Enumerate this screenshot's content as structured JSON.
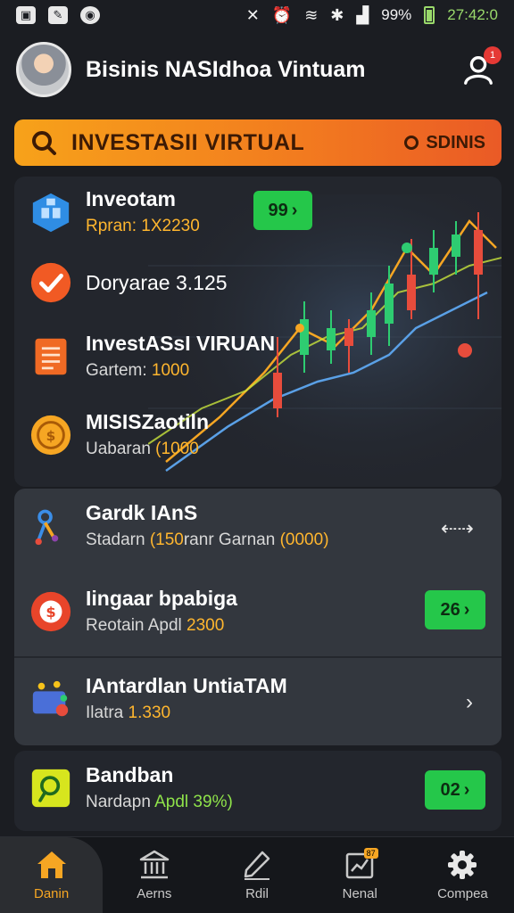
{
  "status_bar": {
    "battery_text": "99%",
    "time": "27:42:0"
  },
  "header": {
    "title": "Bisinis NASIdhoa Vintuam",
    "notification_count": "1"
  },
  "banner": {
    "title": "INVESTASII VIRTUAL",
    "right_label": "SDINIS"
  },
  "card1": {
    "items": [
      {
        "title": "Inveotam",
        "sub_prefix": "",
        "sub_value": "Rpran: 1X2230",
        "pill": "99"
      },
      {
        "title": "Doryarae 3.125",
        "sub_prefix": "",
        "sub_value": ""
      },
      {
        "title": "InvestASsI VIRUAN",
        "sub_prefix": "Gartem: ",
        "sub_value": "1000"
      },
      {
        "title": "MISISZaotiln",
        "sub_prefix": "Uabaran ",
        "sub_value": "(1000"
      }
    ]
  },
  "card2": {
    "items": [
      {
        "title": "Gardk IAnS",
        "sub_prefix": "Stadarn ",
        "sub_value": "(150",
        "sub_mid": "ranr Garnan ",
        "sub_value2": "(0000)",
        "action": "⇠⇢"
      },
      {
        "title": "Iingaar bpabiga",
        "sub_prefix": "Reotain Apdl ",
        "sub_value": "2300",
        "pill": "26"
      },
      {
        "title": "IAntardlan UntiaTAM",
        "sub_prefix": "Ilatra ",
        "sub_value": "1.330"
      }
    ]
  },
  "card3": {
    "title": "Bandban",
    "sub_prefix": "Nardapn ",
    "sub_value": "Apdl 39%)",
    "pill": "02"
  },
  "nav": {
    "items": [
      {
        "label": "Danin",
        "icon": "home-icon"
      },
      {
        "label": "Aerns",
        "icon": "bank-icon"
      },
      {
        "label": "Rdil",
        "icon": "pen-icon"
      },
      {
        "label": "Nenal",
        "icon": "chart-box-icon",
        "badge": "87"
      },
      {
        "label": "Compea",
        "icon": "gear-icon"
      }
    ]
  },
  "colors": {
    "accent_orange": "#f6a623",
    "green_pill": "#25c74a",
    "background": "#1b1d22"
  }
}
